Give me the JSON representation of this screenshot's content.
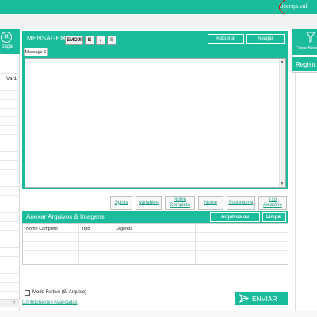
{
  "topbar": {
    "license_text": "Licença váli"
  },
  "left_panel": {
    "clear_button_label": "pagar",
    "clear_icon_glyph": "✕",
    "var_column_label": "Var1"
  },
  "message": {
    "title": "MENSAGEM",
    "format_buttons": {
      "emoji": "EMOJI",
      "bold": "B",
      "italic": "I",
      "strike": "S"
    },
    "add_label": "Adicionar",
    "delete_label": "Apagar",
    "tabs": [
      {
        "label": "Message 1"
      }
    ],
    "body_text": ""
  },
  "insert_buttons": {
    "spoints": "Spints",
    "variables": "Variables",
    "full_name_line1": "Nome",
    "full_name_line2": "Completo",
    "name": "Nome",
    "surname": "Sobrenome",
    "random": "Txo Aleatório"
  },
  "attachments": {
    "title": "Anexar Arquivos & Imagens",
    "files_button": "Arquivos ou",
    "clear_button": "Limpar",
    "columns": [
      "Nome Completo",
      "Tipo",
      "Legenda"
    ],
    "rows": []
  },
  "bottom": {
    "silent_mode_label": "Modo Furtivo (S/ Arquivo)",
    "silent_mode_checked": false,
    "advanced_settings_link": "Configurações Avançadas",
    "send_label": "ENVIAR"
  },
  "right_panel": {
    "filter_label": "Filtrar Núm",
    "registry_title": "Registr"
  },
  "colors": {
    "accent": "#1abc9c",
    "license_highlight": "#e00000",
    "link": "#1a9e83"
  },
  "icons": {
    "clear": "close-circle-icon",
    "filter": "funnel-icon",
    "send": "paper-plane-icon"
  }
}
